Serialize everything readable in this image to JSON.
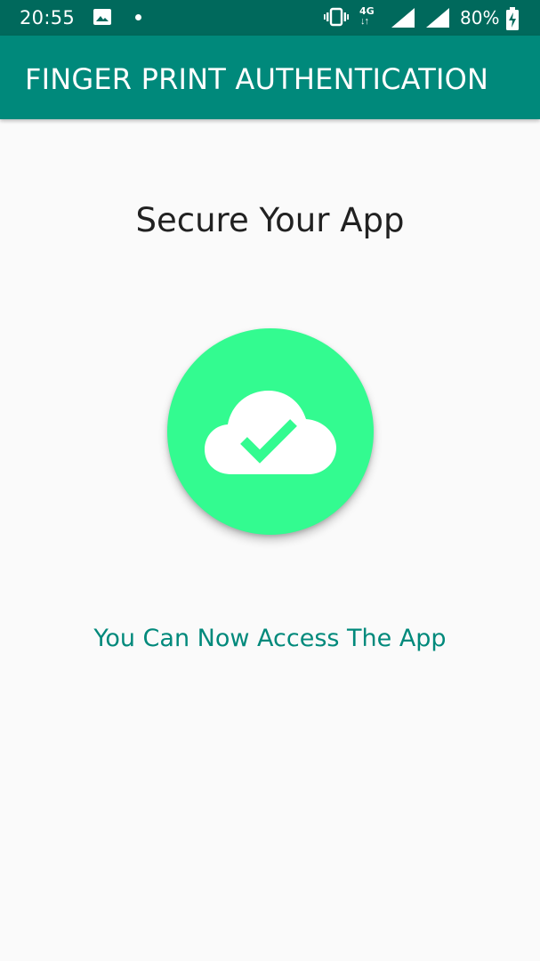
{
  "status_bar": {
    "time": "20:55",
    "network": "4G",
    "network_arrows": "↓↑",
    "battery": "80%"
  },
  "app_bar": {
    "title": "FINGER PRINT AUTHENTICATION"
  },
  "main": {
    "heading": "Secure Your App",
    "status_icon": "cloud-check-icon",
    "message": "You Can Now Access The App"
  },
  "colors": {
    "status_bar": "#00695c",
    "app_bar": "#00897b",
    "circle": "#33fb90",
    "message_text": "#00897b",
    "background": "#fafafa"
  }
}
